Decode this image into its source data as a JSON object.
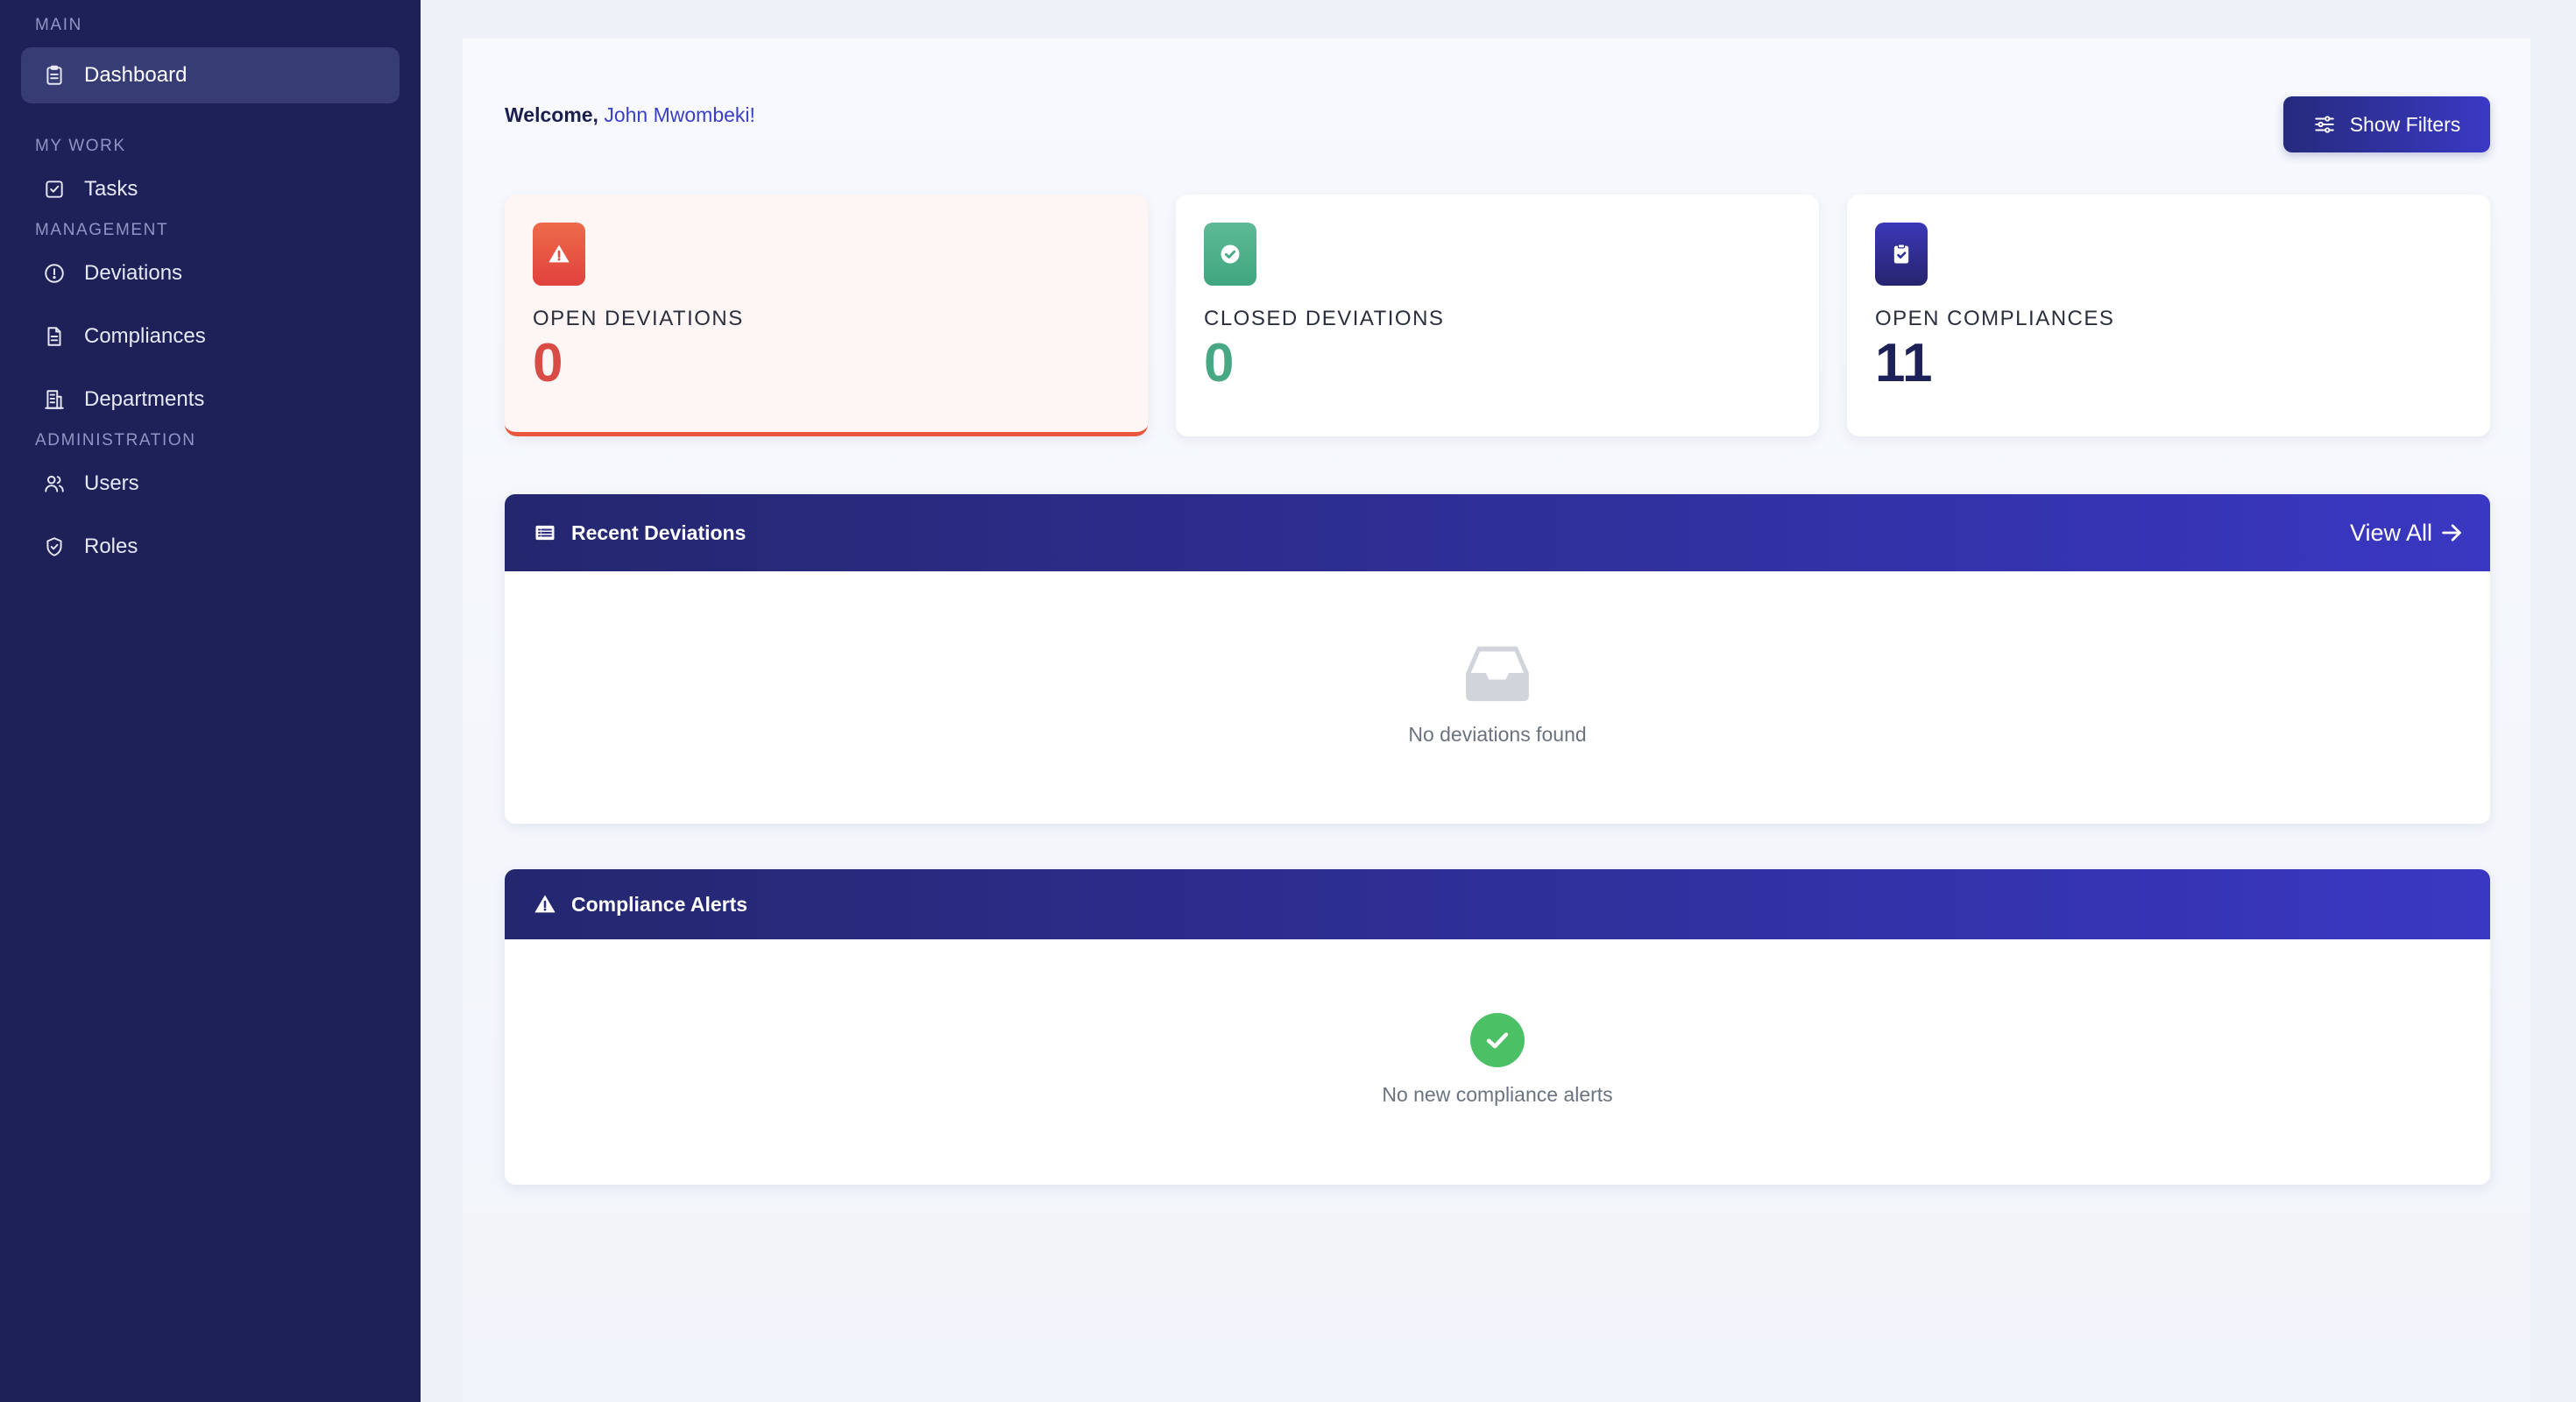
{
  "sidebar": {
    "sections": [
      {
        "title": "MAIN",
        "items": [
          {
            "label": "Dashboard",
            "icon": "clipboard-icon",
            "active": true
          }
        ]
      },
      {
        "title": "MY WORK",
        "items": [
          {
            "label": "Tasks",
            "icon": "checkbox-icon"
          }
        ]
      },
      {
        "title": "MANAGEMENT",
        "items": [
          {
            "label": "Deviations",
            "icon": "alert-circle-icon"
          },
          {
            "label": "Compliances",
            "icon": "document-icon"
          },
          {
            "label": "Departments",
            "icon": "building-icon"
          }
        ]
      },
      {
        "title": "ADMINISTRATION",
        "items": [
          {
            "label": "Users",
            "icon": "users-icon"
          },
          {
            "label": "Roles",
            "icon": "shield-icon"
          }
        ]
      }
    ]
  },
  "header": {
    "welcome_prefix": "Welcome,",
    "user_name": "John Mwombeki!",
    "filter_label": "Show Filters"
  },
  "stats": [
    {
      "label": "OPEN DEVIATIONS",
      "value": "0",
      "icon": "warning-icon",
      "color": "#e0413d"
    },
    {
      "label": "CLOSED DEVIATIONS",
      "value": "0",
      "icon": "check-badge-icon",
      "color": "#3fa67f"
    },
    {
      "label": "OPEN COMPLIANCES",
      "value": "11",
      "icon": "clipboard-check-icon",
      "color": "#26246e"
    }
  ],
  "recent_deviations": {
    "title": "Recent Deviations",
    "view_all": "View All",
    "empty_text": "No deviations found"
  },
  "compliance_alerts": {
    "title": "Compliance Alerts",
    "empty_text": "No new compliance alerts"
  },
  "colors": {
    "sidebar_bg": "#1e2157",
    "accent": "#3a37c2",
    "success": "#4cc065",
    "danger": "#e8573c"
  }
}
